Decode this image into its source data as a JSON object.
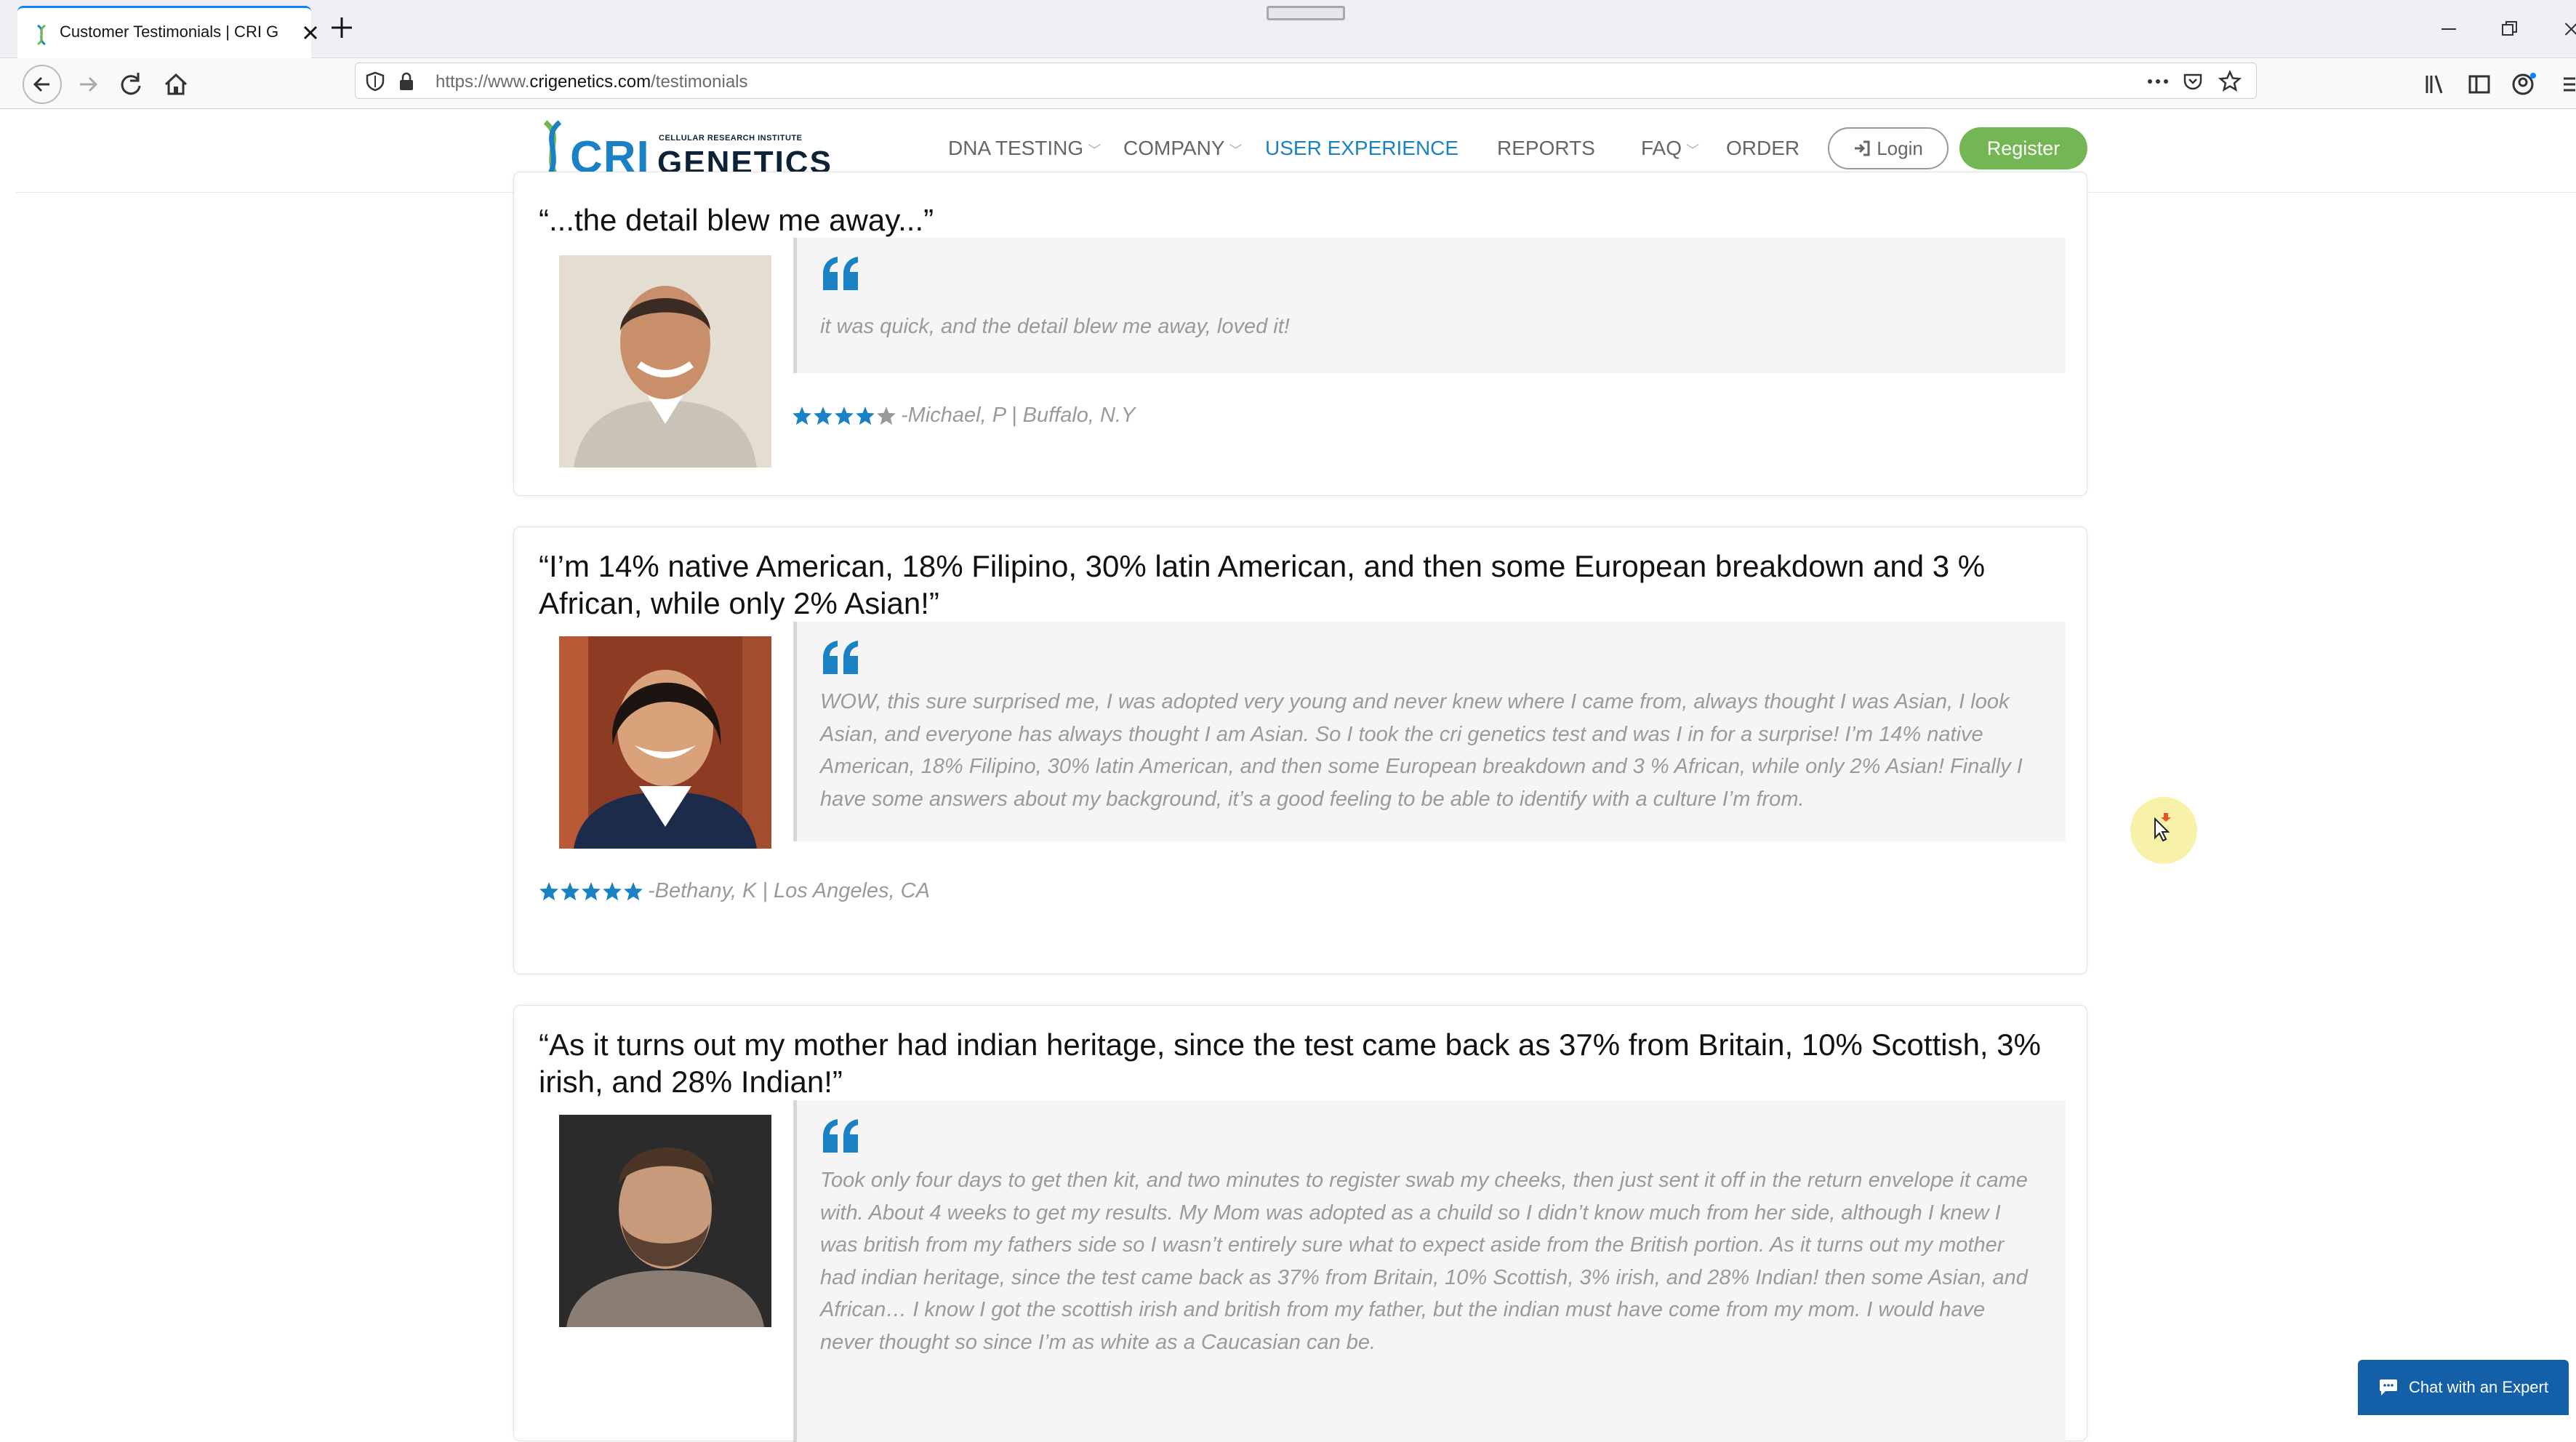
{
  "browser": {
    "tab_title": "Customer Testimonials | CRI Ge",
    "url_prefix": "https://www.",
    "url_host": "crigenetics.com",
    "url_path": "/testimonials",
    "accent": "#0a84ff"
  },
  "header": {
    "logo_word_1": "CRI",
    "logo_word_2": "GENETICS",
    "logo_tagline": "CELLULAR RESEARCH INSTITUTE",
    "menu": [
      {
        "label": "DNA TESTING",
        "dropdown": true
      },
      {
        "label": "COMPANY",
        "dropdown": true
      },
      {
        "label": "USER EXPERIENCE",
        "dropdown": false,
        "active": true
      },
      {
        "label": "REPORTS",
        "dropdown": false
      },
      {
        "label": "FAQ",
        "dropdown": true
      },
      {
        "label": "ORDER",
        "dropdown": false
      }
    ],
    "login_label": "Login",
    "register_label": "Register",
    "brand_blue": "#1a82c4",
    "register_green": "#74b654"
  },
  "testimonials": [
    {
      "title": "“...the detail blew me away...”",
      "quote": "it was quick, and the detail blew me away, loved it!",
      "rating": 4,
      "reviewer": "-Michael, P | Buffalo, N.Y"
    },
    {
      "title": "“I’m 14% native American, 18% Filipino, 30% latin American, and then some European breakdown and 3 % African, while only 2% Asian!”",
      "quote": "WOW, this sure surprised me, I was adopted very young and never knew where I came from, always thought I was Asian, I look Asian, and everyone has always thought I am Asian. So I took the cri genetics test and was I in for a surprise! I’m 14% native American, 18% Filipino, 30% latin American, and then some European breakdown and 3 % African, while only 2% Asian! Finally I have some answers about my background, it’s a good feeling to be able to identify with a culture I’m from.",
      "rating": 5,
      "reviewer": "-Bethany, K | Los Angeles, CA"
    },
    {
      "title": "“As it turns out my mother had indian heritage, since the test came back as 37% from Britain, 10% Scottish, 3% irish, and 28% Indian!”",
      "quote": "Took only four days to get then kit, and two minutes to register swab my cheeks, then just sent it off in the return envelope it came with. About 4 weeks to get my results. My Mom was adopted as a chuild so I didn’t know much from her side, although I knew I was british from my fathers side so I wasn’t entirely sure what to expect aside from the British portion. As it turns out my mother had indian heritage, since the test came back as 37% from Britain, 10% Scottish, 3% irish, and 28% Indian! then some Asian, and African… I know I got the scottish irish and british from my father, but the indian must have come from my mom. I would have never thought so since I’m as white as a Caucasian can be."
    }
  ],
  "chat": {
    "label": "Chat with an Expert",
    "color": "#1460a8"
  }
}
